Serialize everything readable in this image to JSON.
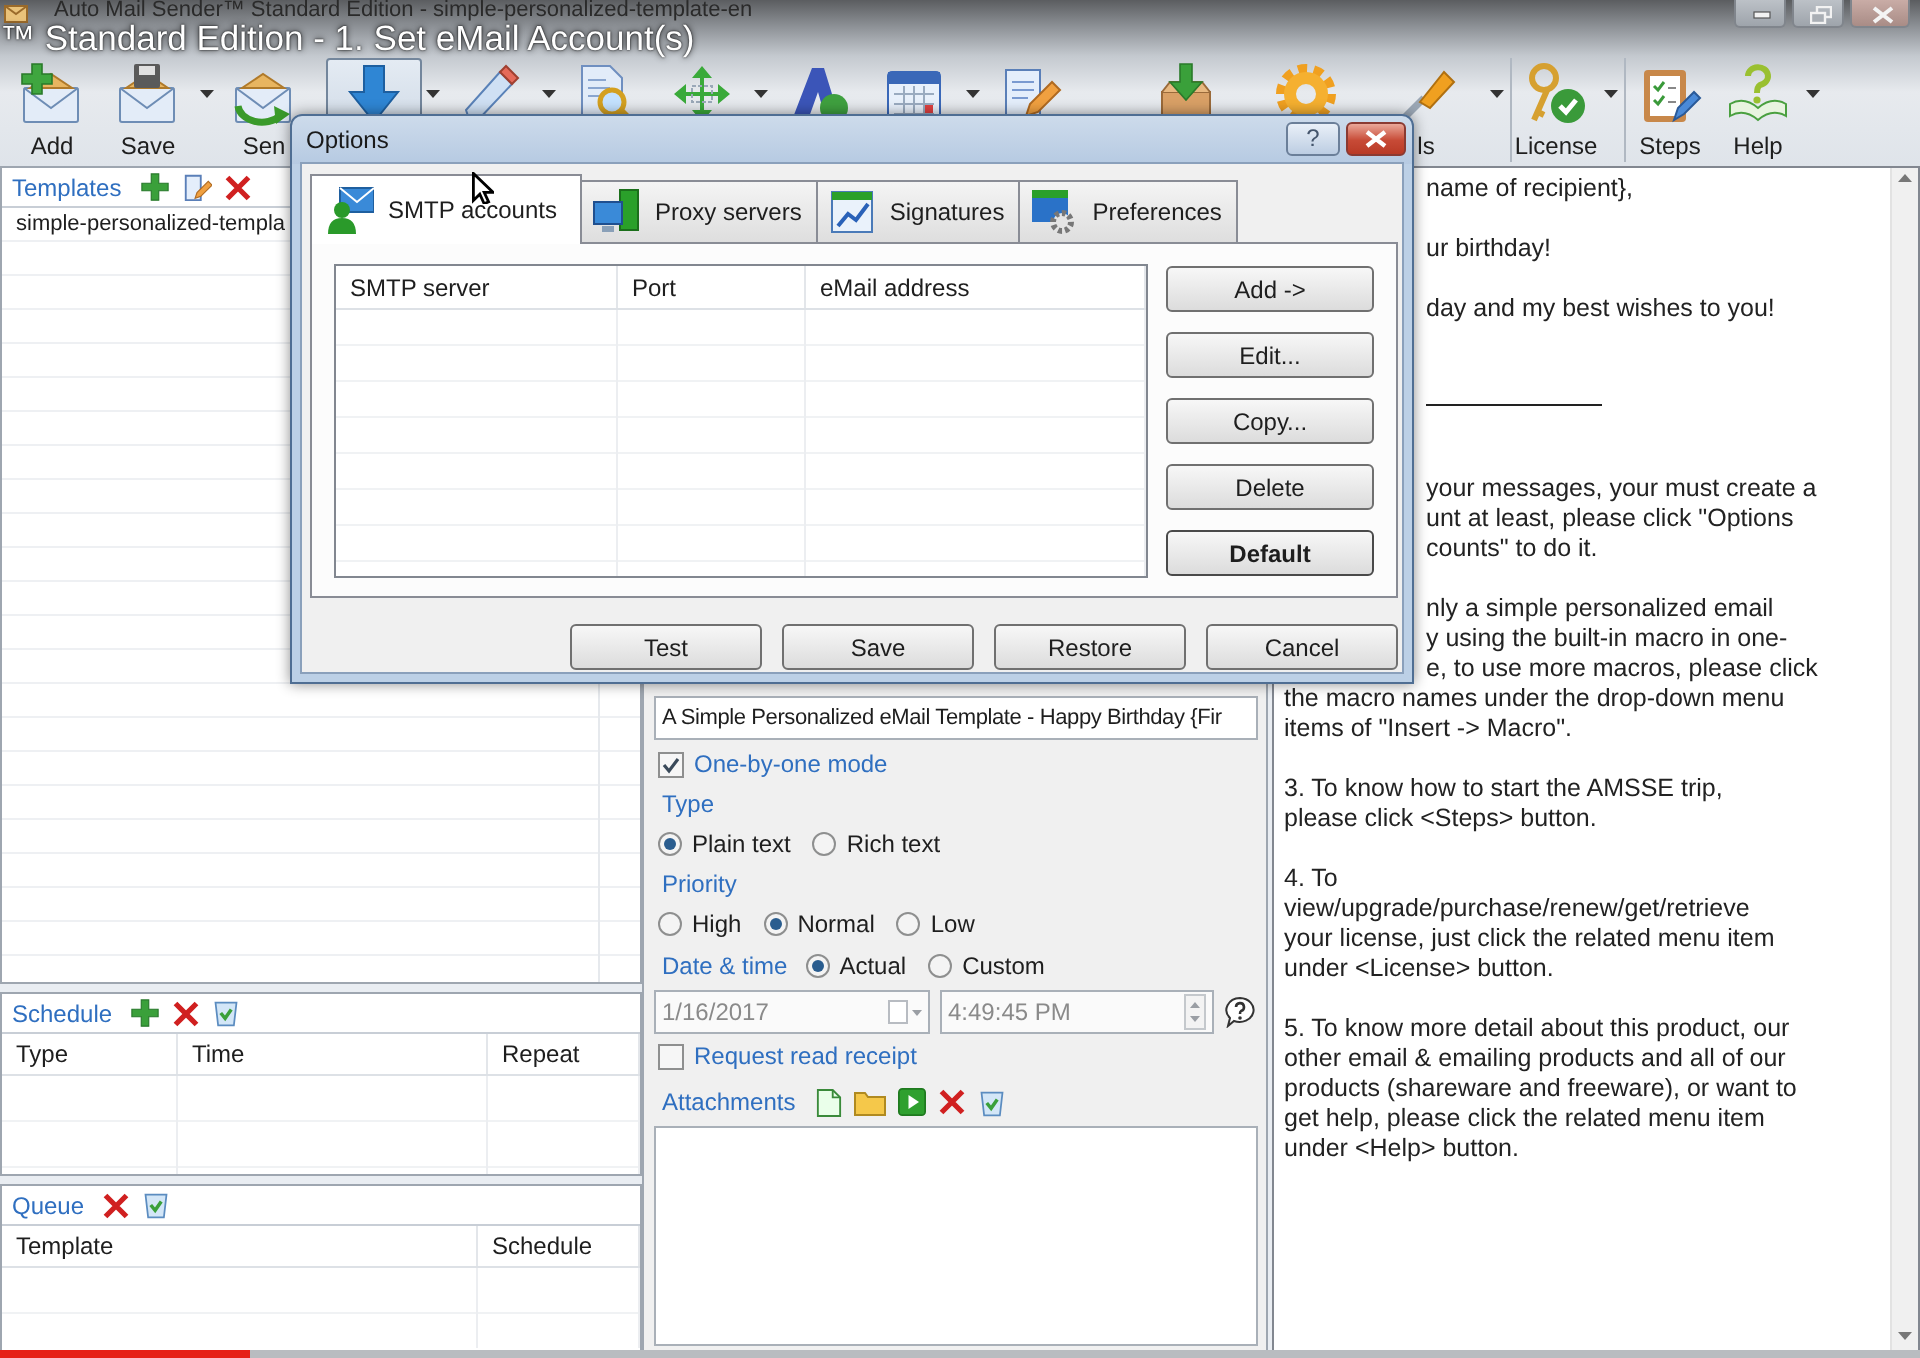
{
  "window": {
    "title": "Auto Mail Sender™ Standard Edition - simple-personalized-template-en"
  },
  "video_overlay": {
    "title": "™ Standard Edition - 1. Set eMail Account(s)",
    "progress": {
      "level": 0.13
    }
  },
  "toolbar": {
    "groups": [
      {
        "items": [
          {
            "label": "Add",
            "dropdown": false,
            "pressed": false
          },
          {
            "label": "Save",
            "dropdown": true,
            "pressed": false
          },
          {
            "label": "Sen",
            "dropdown": false,
            "pressed": false
          }
        ]
      },
      {
        "items": [
          {
            "dropdown": true,
            "pressed": true
          },
          {
            "dropdown": true,
            "pressed": false
          },
          {
            "dropdown": false,
            "pressed": false
          },
          {
            "dropdown": true,
            "pressed": false
          },
          {
            "dropdown": false,
            "pressed": false
          },
          {
            "dropdown": true,
            "pressed": false
          },
          {
            "dropdown": false,
            "pressed": false
          }
        ]
      },
      {
        "items": [
          {
            "dropdown": false,
            "pressed": false
          },
          {
            "dropdown": false,
            "pressed": false
          },
          {
            "label": "ls",
            "dropdown": true,
            "pressed": false
          }
        ]
      },
      {
        "items": [
          {
            "label": "License",
            "dropdown": true,
            "pressed": false
          }
        ]
      },
      {
        "items": [
          {
            "label": "Steps",
            "dropdown": false,
            "pressed": false
          },
          {
            "label": "Help",
            "dropdown": true,
            "pressed": false
          }
        ]
      }
    ]
  },
  "templates": {
    "title": "Templates",
    "items": [
      {
        "name": "simple-personalized-templa",
        "selected": false
      }
    ]
  },
  "schedule": {
    "title": "Schedule",
    "columns": [
      "Type",
      "Time",
      "Repeat"
    ]
  },
  "queue": {
    "title": "Queue",
    "columns": [
      "Template",
      "Schedule"
    ]
  },
  "message": {
    "subject": "A Simple Personalized eMail Template - Happy Birthday {Fir",
    "one_by_one": {
      "label": "One-by-one mode",
      "checked": true
    },
    "type": {
      "label": "Type",
      "options": [
        {
          "label": "Plain text",
          "selected": true
        },
        {
          "label": "Rich text",
          "selected": false
        }
      ]
    },
    "priority": {
      "label": "Priority",
      "options": [
        {
          "label": "High",
          "selected": false
        },
        {
          "label": "Normal",
          "selected": true
        },
        {
          "label": "Low",
          "selected": false
        }
      ]
    },
    "date_time": {
      "label": "Date & time",
      "options": [
        {
          "label": "Actual",
          "selected": true
        },
        {
          "label": "Custom",
          "selected": false
        }
      ],
      "date": "1/16/2017",
      "time": "4:49:45 PM",
      "disabled": true
    },
    "read_receipt": {
      "label": "Request read receipt",
      "checked": false
    },
    "attachments": {
      "label": "Attachments"
    }
  },
  "editor": {
    "lines_beside_dialog": [
      {
        "kind": "text",
        "text": "name of recipient},"
      },
      {
        "kind": "gap"
      },
      {
        "kind": "text",
        "text": "ur birthday!"
      },
      {
        "kind": "gap"
      },
      {
        "kind": "text",
        "text": "day and my best wishes to you!"
      },
      {
        "kind": "gap"
      },
      {
        "kind": "gap"
      },
      {
        "kind": "rule"
      },
      {
        "kind": "gap"
      },
      {
        "kind": "gap"
      },
      {
        "kind": "text",
        "text": "your messages, your must create a"
      },
      {
        "kind": "text",
        "text": "unt at least, please click \"Options"
      },
      {
        "kind": "text",
        "text": "counts\" to do it."
      },
      {
        "kind": "gap"
      },
      {
        "kind": "text",
        "text": "nly a simple personalized email"
      },
      {
        "kind": "text",
        "text": "y using the built-in macro in one-"
      },
      {
        "kind": "text",
        "text": "e, to use more macros, please click"
      }
    ],
    "lines": [
      {
        "kind": "text",
        "text": "the macro names under the drop-down menu"
      },
      {
        "kind": "text",
        "text": "items of \"Insert -> Macro\"."
      },
      {
        "kind": "gap"
      },
      {
        "kind": "text",
        "text": "3. To know how to start the AMSSE trip,"
      },
      {
        "kind": "text",
        "text": "please click <Steps> button."
      },
      {
        "kind": "gap"
      },
      {
        "kind": "text",
        "text": "4. To"
      },
      {
        "kind": "text",
        "text": "view/upgrade/purchase/renew/get/retrieve"
      },
      {
        "kind": "text",
        "text": "your license, just click the related menu item"
      },
      {
        "kind": "text",
        "text": "under <License> button."
      },
      {
        "kind": "gap"
      },
      {
        "kind": "text",
        "text": "5. To know more detail about this product, our"
      },
      {
        "kind": "text",
        "text": "other email & emailing products and all of our"
      },
      {
        "kind": "text",
        "text": "products (shareware and freeware), or want to"
      },
      {
        "kind": "text",
        "text": "get help, please click the related menu item"
      },
      {
        "kind": "text",
        "text": "under <Help> button."
      }
    ]
  },
  "dialog": {
    "title": "Options",
    "help": "?",
    "tabs": [
      {
        "label": "SMTP accounts",
        "selected": true
      },
      {
        "label": "Proxy servers",
        "selected": false
      },
      {
        "label": "Signatures",
        "selected": false
      },
      {
        "label": "Preferences",
        "selected": false
      }
    ],
    "accounts": {
      "columns": [
        "SMTP server",
        "Port",
        "eMail address"
      ]
    },
    "side_buttons": [
      {
        "label": "Add ->",
        "primary": false
      },
      {
        "label": "Edit...",
        "primary": false
      },
      {
        "label": "Copy...",
        "primary": false
      },
      {
        "label": "Delete",
        "primary": false
      },
      {
        "label": "Default",
        "primary": true
      }
    ],
    "buttons": [
      "Test",
      "Save",
      "Restore",
      "Cancel"
    ]
  }
}
